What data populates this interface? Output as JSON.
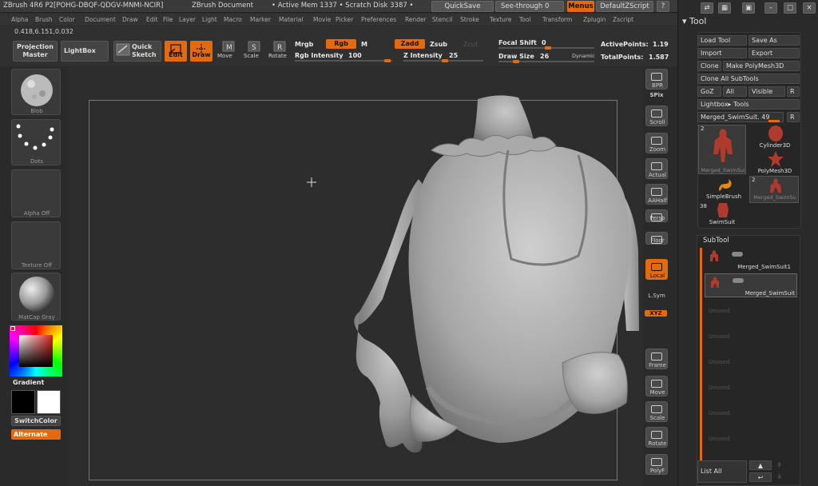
{
  "titlebar": {
    "app": "ZBrush 4R6 P2[POHG-DBQF-QDGV-MNMI-NCIR]",
    "doc": "ZBrush Document",
    "mem": "• Active Mem 1337  • Scratch Disk 3387  •",
    "quicksave": "QuickSave",
    "seethrough": "See-through  0",
    "menus": "Menus",
    "script": "DefaultZScript"
  },
  "menubar": {
    "items": [
      "Alpha",
      "Brush",
      "Color",
      "Document",
      "Draw",
      "Edit",
      "File",
      "Layer",
      "Light",
      "Macro",
      "Marker",
      "Material",
      "Movie",
      "Picker",
      "Preferences",
      "Render",
      "Stencil",
      "Stroke",
      "Texture",
      "Tool",
      "Transform",
      "Zplugin",
      "Zscript"
    ]
  },
  "toolbar": {
    "coords": "0.418,6.151,0.032",
    "projection_master": "Projection Master",
    "lightbox": "LightBox",
    "quick_sketch": "Quick Sketch",
    "edit": "Edit",
    "draw": "Draw",
    "move": "Move",
    "scale": "Scale",
    "rotate": "Rotate",
    "mrgb": "Mrgb",
    "rgb": "Rgb",
    "m": "M",
    "zadd": "Zadd",
    "zsub": "Zsub",
    "zcut": "Zcut",
    "rgb_intensity_label": "Rgb Intensity",
    "rgb_intensity": 100,
    "z_intensity_label": "Z Intensity",
    "z_intensity": 25,
    "focal_shift_label": "Focal Shift",
    "focal_shift": 0,
    "draw_size_label": "Draw Size",
    "draw_size": 26,
    "dynamic": "Dynamic",
    "active_points_label": "ActivePoints:",
    "active_points": "1.19",
    "total_points_label": "TotalPoints:",
    "total_points": "1.587"
  },
  "leftshelf": {
    "brush": "Blob",
    "stroke": "Dots",
    "alpha": "Alpha  Off",
    "texture": "Texture  Off",
    "material": "MatCap  Gray",
    "gradient": "Gradient",
    "switchcolor": "SwitchColor",
    "alternate": "Alternate"
  },
  "rightshelf": {
    "buttons": [
      "BPR",
      "SPix",
      "Scroll",
      "Zoom",
      "Actual",
      "AAHalf",
      "Persp",
      "Floor",
      "Local",
      "L.Sym",
      "XYZ",
      "Frame",
      "Move",
      "Scale",
      "Rotate",
      "PolyF"
    ]
  },
  "toolpanel": {
    "title": "Tool",
    "load_tool": "Load Tool",
    "save_as": "Save As",
    "import": "Import",
    "export": "Export",
    "clone": "Clone",
    "make_polymesh": "Make PolyMesh3D",
    "clone_all": "Clone All SubTools",
    "goz": "GoZ",
    "all": "All",
    "visible": "Visible",
    "r": "R",
    "lightbox_tools": "Lightbox▸ Tools",
    "current_tool": "Merged_SwimSuit. 49",
    "tools": [
      {
        "name": "Merged_SwimSui",
        "count": "2"
      },
      {
        "name": "Cylinder3D",
        "count": ""
      },
      {
        "name": "PolyMesh3D",
        "count": ""
      },
      {
        "name": "SimpleBrush",
        "count": ""
      },
      {
        "name": "Merged_SwimSu",
        "count": "2"
      },
      {
        "name": "SwimSuit",
        "count": "38"
      }
    ],
    "subtool_header": "SubTool",
    "subtools": [
      "Merged_SwimSuit1",
      "Merged_SwimSuit"
    ],
    "empty_slots": [
      "Unused",
      "Unused",
      "Unused",
      "Unused",
      "Unused",
      "Unused"
    ],
    "list_all": "List All"
  },
  "colors": {
    "accent": "#e56a0f",
    "bg": "#2b2b2b",
    "panel": "#3c3c3c"
  }
}
